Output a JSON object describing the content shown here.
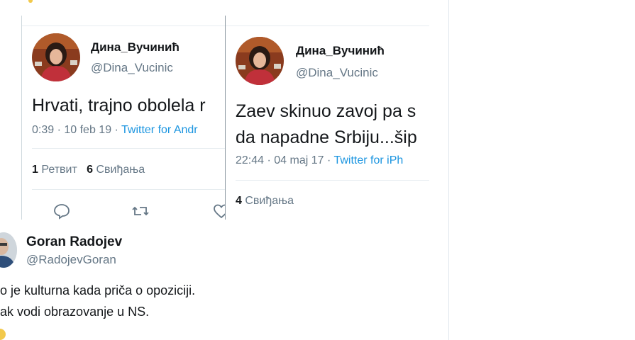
{
  "card1": {
    "display_name": "Дина_Вучинић",
    "handle": "@Dina_Vucinic",
    "text_line1": "Hrvati, trajno obolela r",
    "time_date": "0:39 · 10 feb 19 · ",
    "source": "Twitter for Andr",
    "retweets_count": "1",
    "retweets_label": " Ретвит",
    "likes_count": "6",
    "likes_label": " Свиђања",
    "icons": [
      "reply-icon",
      "retweet-icon",
      "like-icon"
    ]
  },
  "card2": {
    "display_name": "Дина_Вучинић",
    "handle": "@Dina_Vucinic",
    "text_line1": "Zaev skinuo zavoj pa s",
    "text_line2": "da napadne Srbiju...šip",
    "time_date": "22:44 · 04 maj 17 · ",
    "source": "Twitter for iPh",
    "likes_count": "4",
    "likes_label": " Свиђања"
  },
  "outer_tweet": {
    "display_name": "Goran Radojev",
    "handle": "@RadojevGoran",
    "line1": "o je kulturna kada priča o opoziciji.",
    "line2": "ak vodi obrazovanje u NS."
  },
  "colors": {
    "link": "#1b95e0",
    "secondary_text": "#657786",
    "primary_text": "#14171a",
    "divider": "#e6ecf0"
  }
}
